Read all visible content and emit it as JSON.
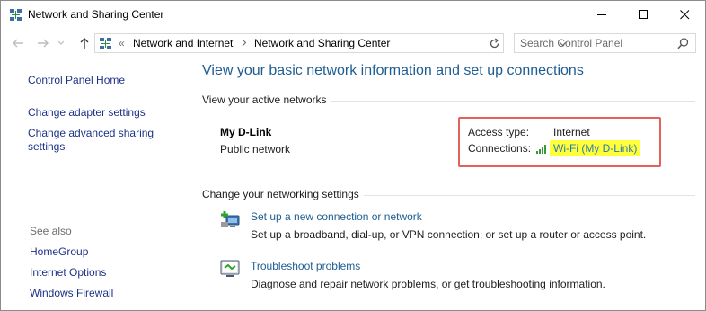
{
  "window": {
    "title": "Network and Sharing Center",
    "controls": [
      "minimize",
      "maximize",
      "close"
    ]
  },
  "address_bar": {
    "overflow": "«",
    "crumbs": [
      "Network and Internet",
      "Network and Sharing Center"
    ]
  },
  "search": {
    "placeholder": "Search Control Panel"
  },
  "sidebar": {
    "home": "Control Panel Home",
    "links": [
      "Change adapter settings",
      "Change advanced sharing",
      "settings"
    ],
    "see_also_heading": "See also",
    "see_also": [
      "HomeGroup",
      "Internet Options",
      "Windows Firewall"
    ]
  },
  "main": {
    "title": "View your basic network information and set up connections",
    "active_heading": "View your active networks",
    "network": {
      "name": "My D-Link",
      "category": "Public network",
      "access_type_label": "Access type:",
      "access_type_value": "Internet",
      "connections_label": "Connections:",
      "connection_name": "Wi-Fi (My D-Link)"
    },
    "change_heading": "Change your networking settings",
    "tasks": [
      {
        "icon": "new-connection-icon",
        "link": "Set up a new connection or network",
        "description": "Set up a broadband, dial-up, or VPN connection; or set up a router or access point."
      },
      {
        "icon": "troubleshoot-icon",
        "link": "Troubleshoot problems",
        "description": "Diagnose and repair network problems, or get troubleshooting information."
      }
    ]
  },
  "colors": {
    "link": "#1e3287",
    "title_blue": "#1e5d91",
    "highlight_border": "#e0635a",
    "highlight_fill": "#ffff3a"
  }
}
